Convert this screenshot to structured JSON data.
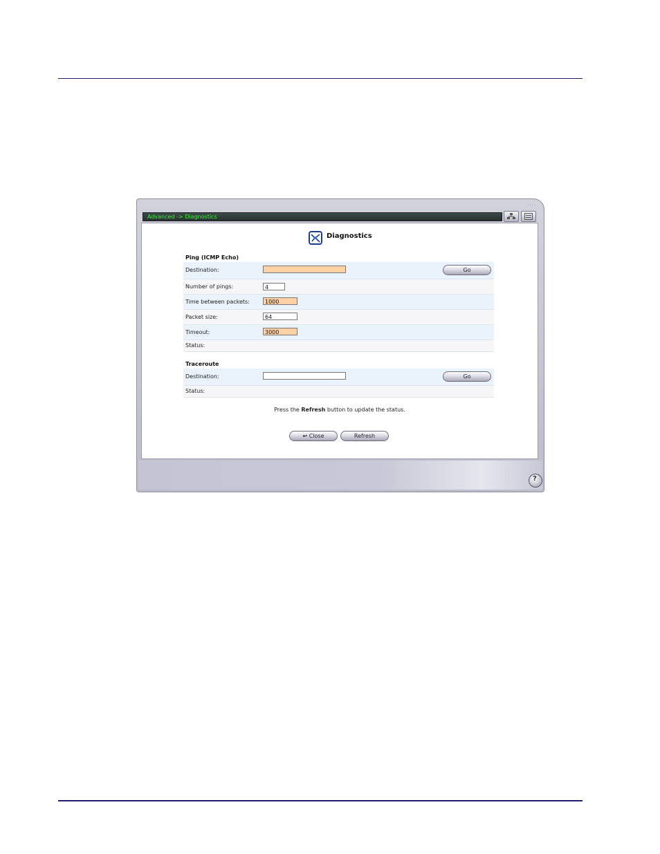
{
  "window": {
    "breadcrumb": "Advanced -> Diagnostics",
    "grip": "....",
    "help_glyph": "?"
  },
  "header": {
    "title": "Diagnostics"
  },
  "ping": {
    "section_title": "Ping (ICMP Echo)",
    "destination_label": "Destination:",
    "destination_value": "",
    "go_label": "Go",
    "num_pings_label": "Number of pings:",
    "num_pings_value": "4",
    "time_between_label": "Time between packets:",
    "time_between_value": "1000",
    "packet_size_label": "Packet size:",
    "packet_size_value": "64",
    "timeout_label": "Timeout:",
    "timeout_value": "3000",
    "status_label": "Status:"
  },
  "traceroute": {
    "section_title": "Traceroute",
    "destination_label": "Destination:",
    "destination_value": "",
    "go_label": "Go",
    "status_label": "Status:"
  },
  "note": {
    "prefix": "Press the ",
    "bold": "Refresh",
    "suffix": " button to update the status."
  },
  "buttons": {
    "close_label": "Close",
    "close_glyph": "↩",
    "refresh_label": "Refresh"
  }
}
